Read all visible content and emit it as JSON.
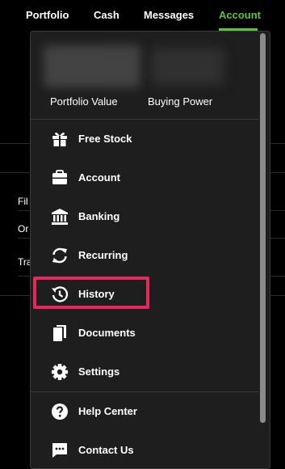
{
  "nav": {
    "tabs": [
      {
        "label": "Portfolio"
      },
      {
        "label": "Cash"
      },
      {
        "label": "Messages"
      },
      {
        "label": "Account"
      }
    ]
  },
  "background": {
    "rows": [
      "Fil",
      "Or",
      "Tra"
    ]
  },
  "menu": {
    "stats": {
      "portfolio_value_label": "Portfolio Value",
      "buying_power_label": "Buying Power"
    },
    "items": [
      {
        "label": "Free Stock",
        "icon": "gift-icon"
      },
      {
        "label": "Account",
        "icon": "briefcase-icon"
      },
      {
        "label": "Banking",
        "icon": "bank-icon"
      },
      {
        "label": "Recurring",
        "icon": "recurring-icon"
      },
      {
        "label": "History",
        "icon": "history-icon"
      },
      {
        "label": "Documents",
        "icon": "documents-icon"
      },
      {
        "label": "Settings",
        "icon": "gear-icon"
      },
      {
        "label": "Help Center",
        "icon": "help-icon"
      },
      {
        "label": "Contact Us",
        "icon": "chat-icon"
      }
    ]
  },
  "colors": {
    "accent": "#5ac53b",
    "highlight": "#e8275b",
    "menu_bg": "#1e1e1e",
    "page_bg": "#000000"
  }
}
